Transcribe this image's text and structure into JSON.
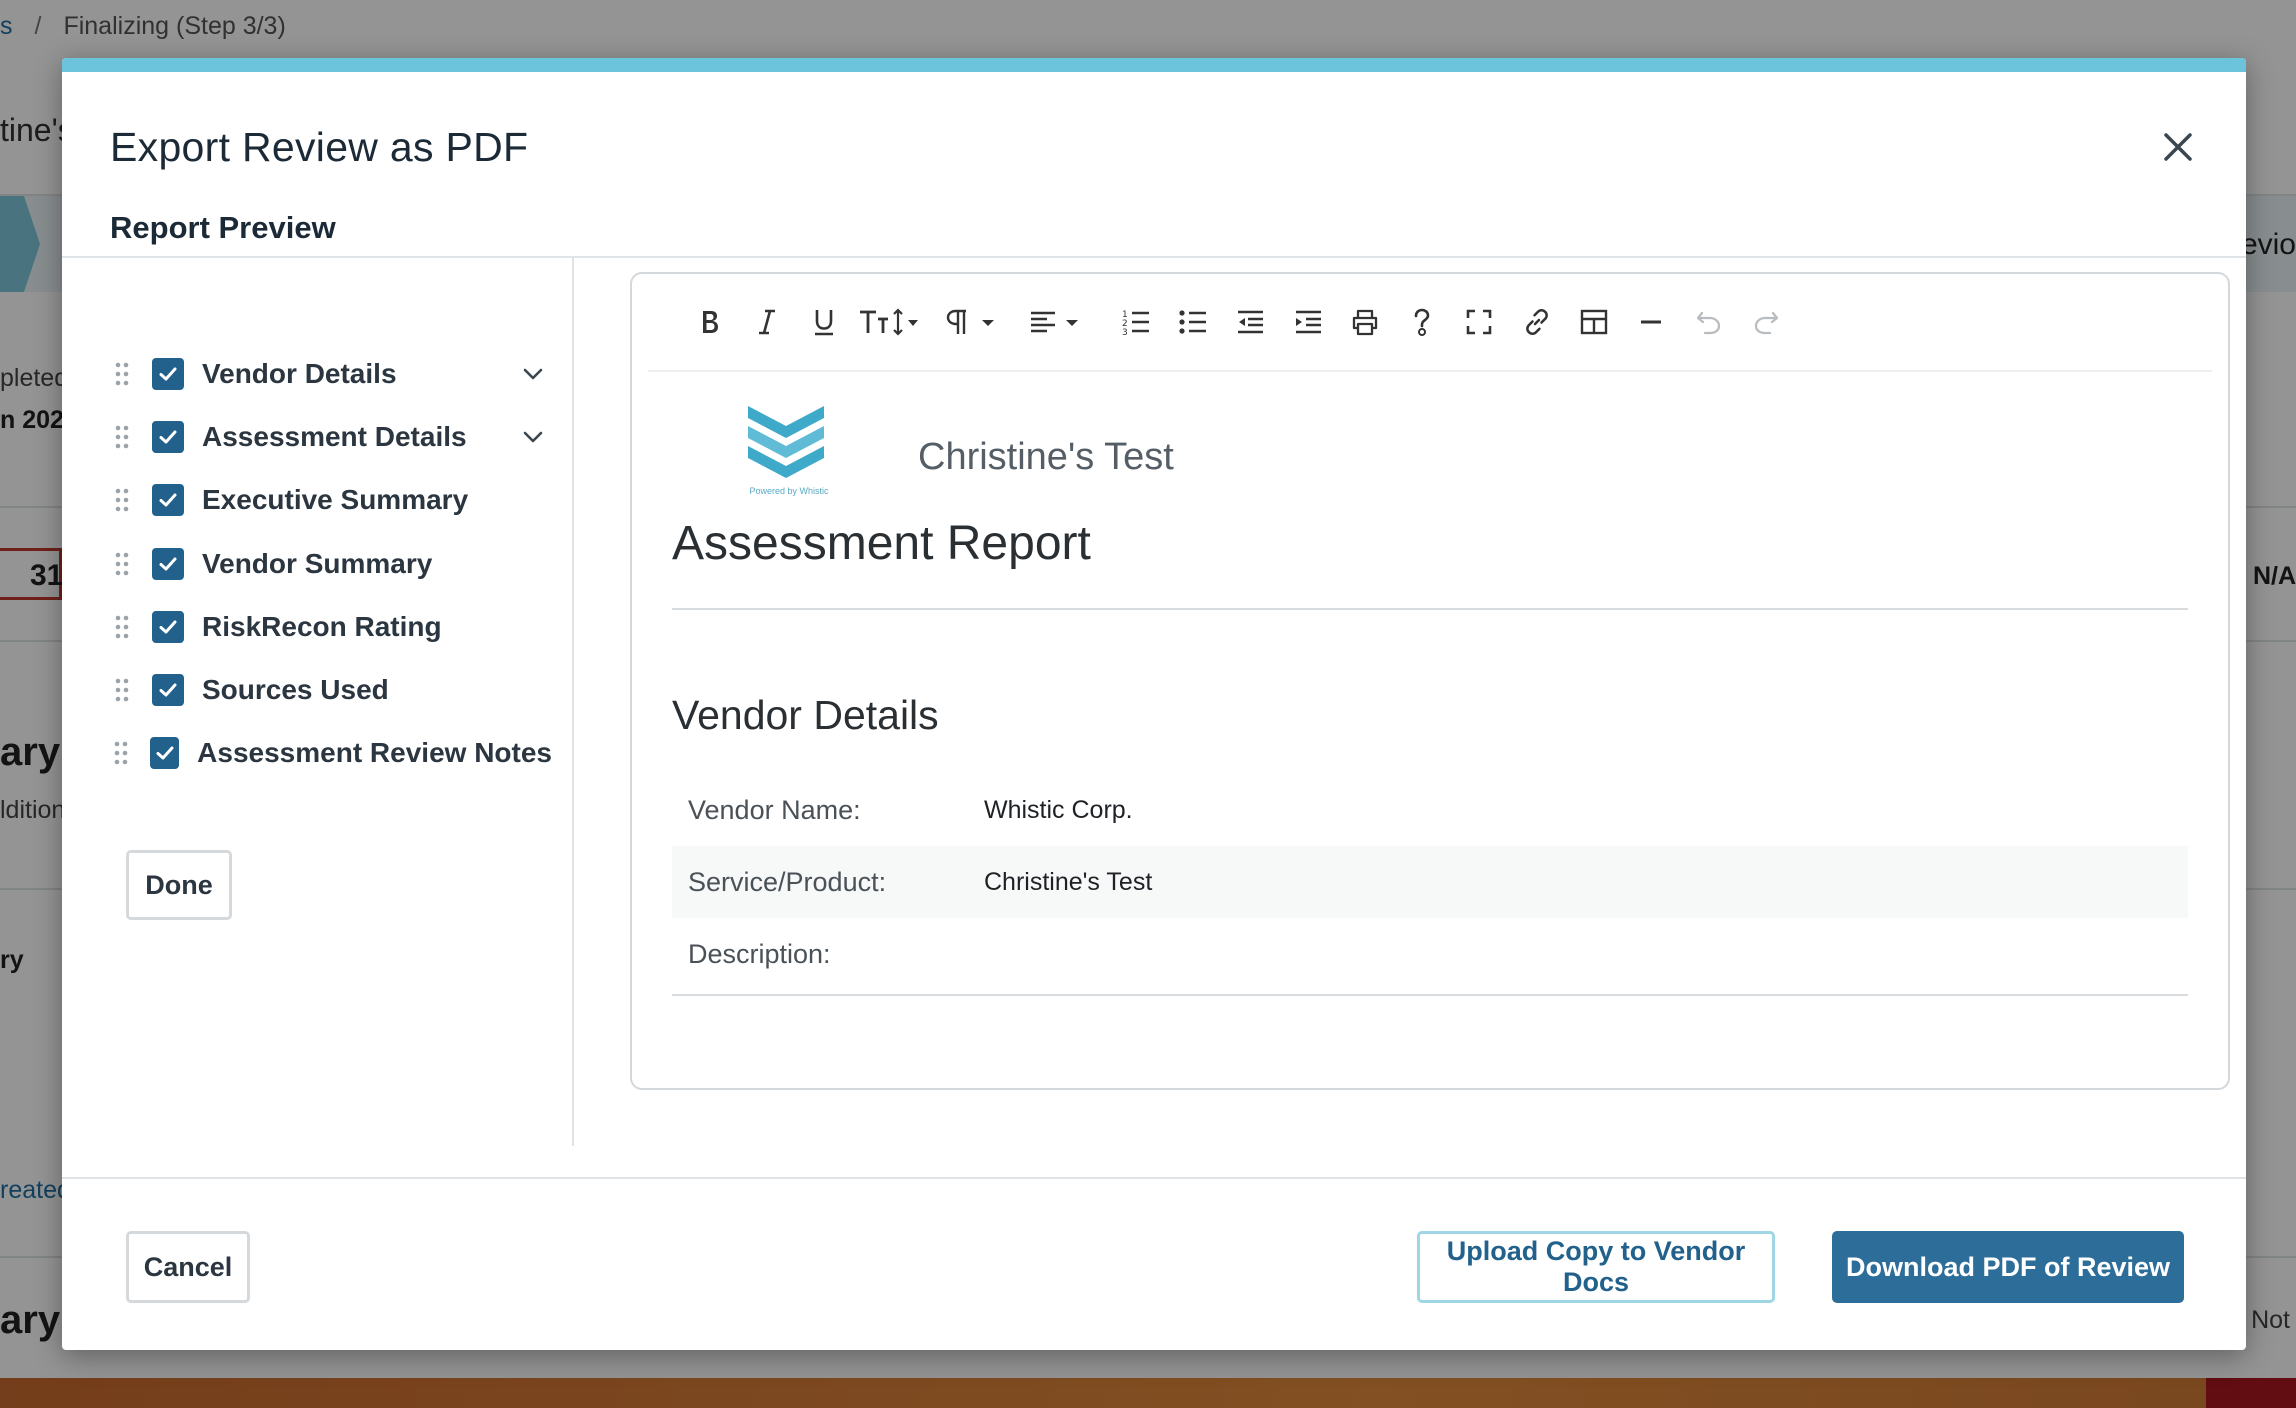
{
  "background": {
    "breadcrumb": {
      "link_fragment": "s",
      "separator": "/",
      "current": "Finalizing (Step 3/3)"
    },
    "left_fragments": {
      "vendor_name": "tine's",
      "completed": "pleted",
      "date": "n 202",
      "score": "31",
      "summary_heading": "ary",
      "additional": "ldition",
      "summary_sub": "ry",
      "created": "reated",
      "bottom_heading": "ary"
    },
    "right_fragments": {
      "step_label": "evio",
      "na_value": ": N/A",
      "not_value": "Not"
    }
  },
  "modal": {
    "title": "Export Review as PDF",
    "section_title": "Report Preview",
    "sections": [
      {
        "label": "Vendor Details",
        "checked": true,
        "expandable": true
      },
      {
        "label": "Assessment Details",
        "checked": true,
        "expandable": true
      },
      {
        "label": "Executive Summary",
        "checked": true,
        "expandable": false
      },
      {
        "label": "Vendor Summary",
        "checked": true,
        "expandable": false
      },
      {
        "label": "RiskRecon Rating",
        "checked": true,
        "expandable": false
      },
      {
        "label": "Sources Used",
        "checked": true,
        "expandable": false
      },
      {
        "label": "Assessment Review Notes",
        "checked": true,
        "expandable": false
      }
    ],
    "done_label": "Done",
    "toolbar_icons": [
      "bold-icon",
      "italic-icon",
      "underline-icon",
      "font-size-icon",
      "paragraph-format-icon",
      "align-icon",
      "ordered-list-icon",
      "unordered-list-icon",
      "outdent-icon",
      "indent-icon",
      "print-icon",
      "help-icon",
      "fullscreen-icon",
      "link-icon",
      "table-icon",
      "horizontal-line-icon",
      "undo-icon",
      "redo-icon"
    ],
    "document": {
      "logo_caption": "Powered by Whistic",
      "company_name": "Christine's Test",
      "report_title": "Assessment Report",
      "vendor_details_title": "Vendor Details",
      "rows": [
        {
          "key": "Vendor Name:",
          "value": "Whistic Corp."
        },
        {
          "key": "Service/Product:",
          "value": "Christine's Test"
        },
        {
          "key": "Description:",
          "value": ""
        }
      ]
    },
    "footer": {
      "cancel_label": "Cancel",
      "upload_label": "Upload Copy to Vendor Docs",
      "download_label": "Download PDF of Review"
    },
    "colors": {
      "accent_bar": "#6cc3dc",
      "checkbox": "#21618c",
      "primary_button": "#2d6d99"
    }
  }
}
